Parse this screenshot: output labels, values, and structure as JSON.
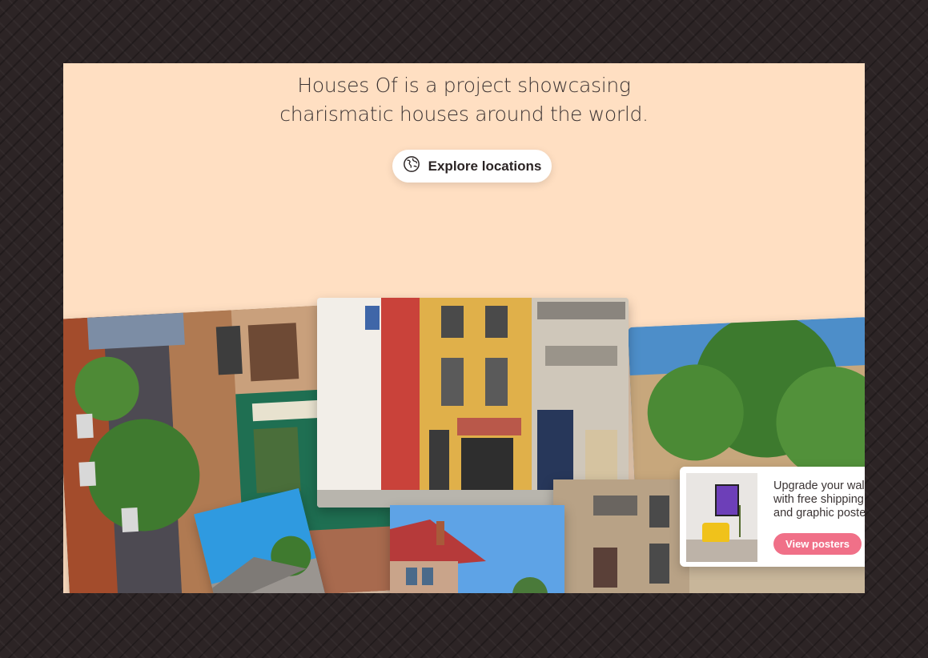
{
  "intro": {
    "line1": "Houses Of is a project showcasing",
    "line2": "charismatic houses around the world."
  },
  "explore_button": {
    "label": "Explore locations",
    "icon": "globe-icon"
  },
  "photos": [
    {
      "name": "photo-amsterdam-houses"
    },
    {
      "name": "photo-colorful-facades"
    },
    {
      "name": "photo-tree-street"
    },
    {
      "name": "photo-red-roof-house"
    },
    {
      "name": "photo-stone-balconies"
    },
    {
      "name": "photo-blue-sky-roof"
    }
  ],
  "poster_promo": {
    "text": "Upgrade your wall with free shipping and graphic posters.",
    "button_label": "View posters"
  },
  "colors": {
    "page_bg": "#2c2425",
    "panel_bg": "#ffdfc2",
    "accent": "#f07088",
    "text": "#3b3333"
  }
}
